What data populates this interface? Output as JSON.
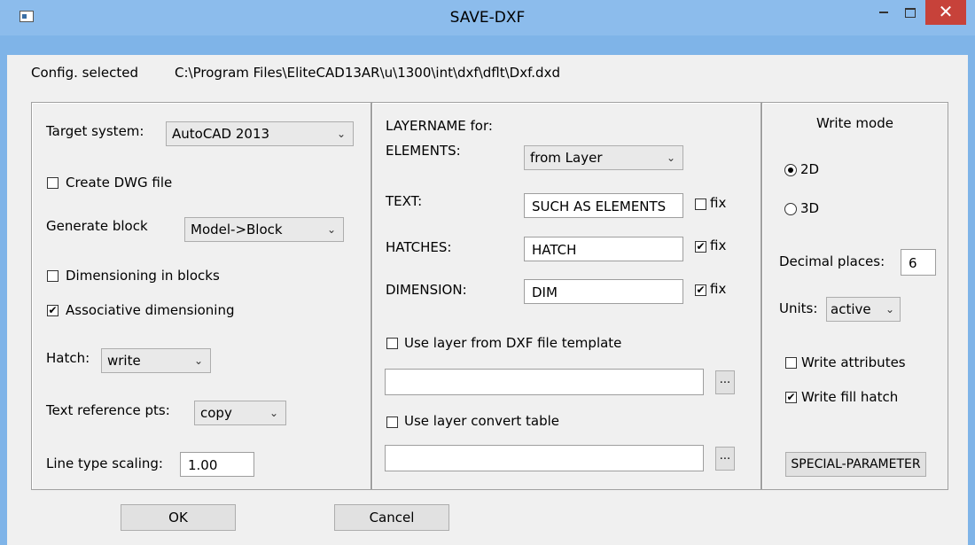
{
  "window": {
    "title": "SAVE-DXF"
  },
  "config": {
    "label": "Config. selected",
    "path": "C:\\Program Files\\EliteCAD13AR\\u\\1300\\int\\dxf\\dflt\\Dxf.dxd"
  },
  "left": {
    "target_label": "Target system:",
    "target_value": "AutoCAD 2013",
    "create_dwg": {
      "label": "Create DWG file",
      "checked": false
    },
    "generate_block_label": "Generate block",
    "generate_block_value": "Model->Block",
    "dim_in_blocks": {
      "label": "Dimensioning in blocks",
      "checked": false
    },
    "assoc_dim": {
      "label": "Associative dimensioning",
      "checked": true
    },
    "hatch_label": "Hatch:",
    "hatch_value": "write",
    "text_ref_label": "Text reference pts:",
    "text_ref_value": "copy",
    "line_scale_label": "Line type scaling:",
    "line_scale_value": "1.00"
  },
  "middle": {
    "layername_label": "LAYERNAME for:",
    "elements_label": "ELEMENTS:",
    "elements_value": "from Layer",
    "text_label": "TEXT:",
    "text_value": "SUCH AS ELEMENTS",
    "text_fix": {
      "label": "fix",
      "checked": false
    },
    "hatches_label": "HATCHES:",
    "hatches_value": "HATCH",
    "hatches_fix": {
      "label": "fix",
      "checked": true
    },
    "dimension_label": "DIMENSION:",
    "dimension_value": "DIM",
    "dimension_fix": {
      "label": "fix",
      "checked": true
    },
    "use_template": {
      "label": "Use layer from DXF file template",
      "checked": false
    },
    "template_path": "",
    "use_convert": {
      "label": "Use layer convert table",
      "checked": false
    },
    "convert_path": "",
    "browse_label": "..."
  },
  "right": {
    "write_mode_label": "Write mode",
    "mode_2d": {
      "label": "2D",
      "selected": true
    },
    "mode_3d": {
      "label": "3D",
      "selected": false
    },
    "decimal_label": "Decimal places:",
    "decimal_value": "6",
    "units_label": "Units:",
    "units_value": "active",
    "write_attributes": {
      "label": "Write attributes",
      "checked": false
    },
    "write_fill_hatch": {
      "label": "Write fill hatch",
      "checked": true
    },
    "special_button": "SPECIAL-PARAMETER"
  },
  "buttons": {
    "ok": "OK",
    "cancel": "Cancel"
  },
  "icons": {
    "check_glyph": "✔",
    "chevron_glyph": "⌄",
    "close_glyph": "✕"
  }
}
